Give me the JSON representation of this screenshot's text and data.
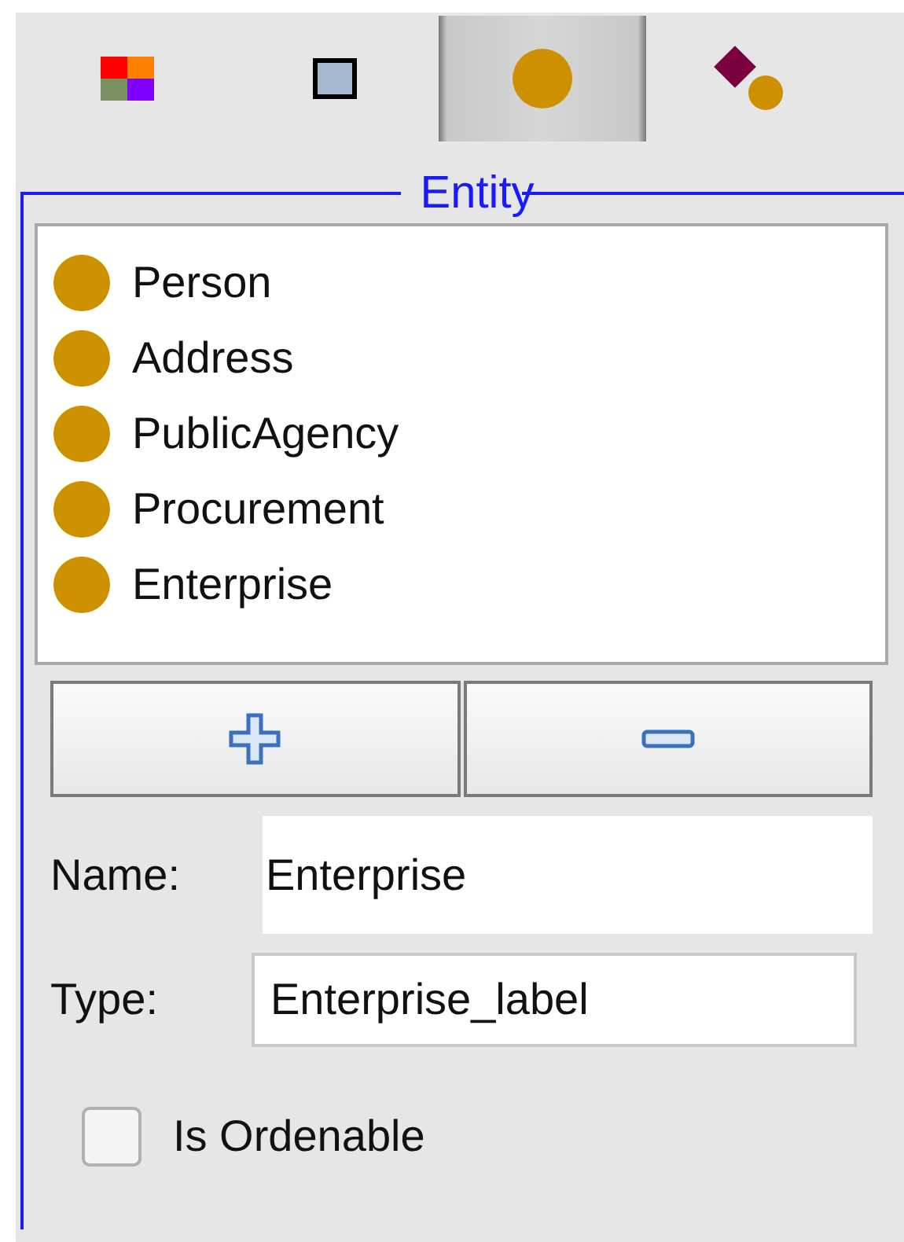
{
  "toolbar": [
    {
      "kind": "palette",
      "selected": false
    },
    {
      "kind": "square",
      "selected": false
    },
    {
      "kind": "circle",
      "selected": true
    },
    {
      "kind": "link",
      "selected": false
    }
  ],
  "panel": {
    "title": "Entity",
    "entities": [
      {
        "label": "Person",
        "selected": false
      },
      {
        "label": "Address",
        "selected": false
      },
      {
        "label": "PublicAgency",
        "selected": false
      },
      {
        "label": "Procurement",
        "selected": false
      },
      {
        "label": "Enterprise",
        "selected": false
      }
    ],
    "name": {
      "label": "Name:",
      "value": "Enterprise"
    },
    "type": {
      "label": "Type:",
      "value": "Enterprise_label"
    },
    "ordenable": {
      "label": "Is Ordenable",
      "checked": false
    }
  }
}
